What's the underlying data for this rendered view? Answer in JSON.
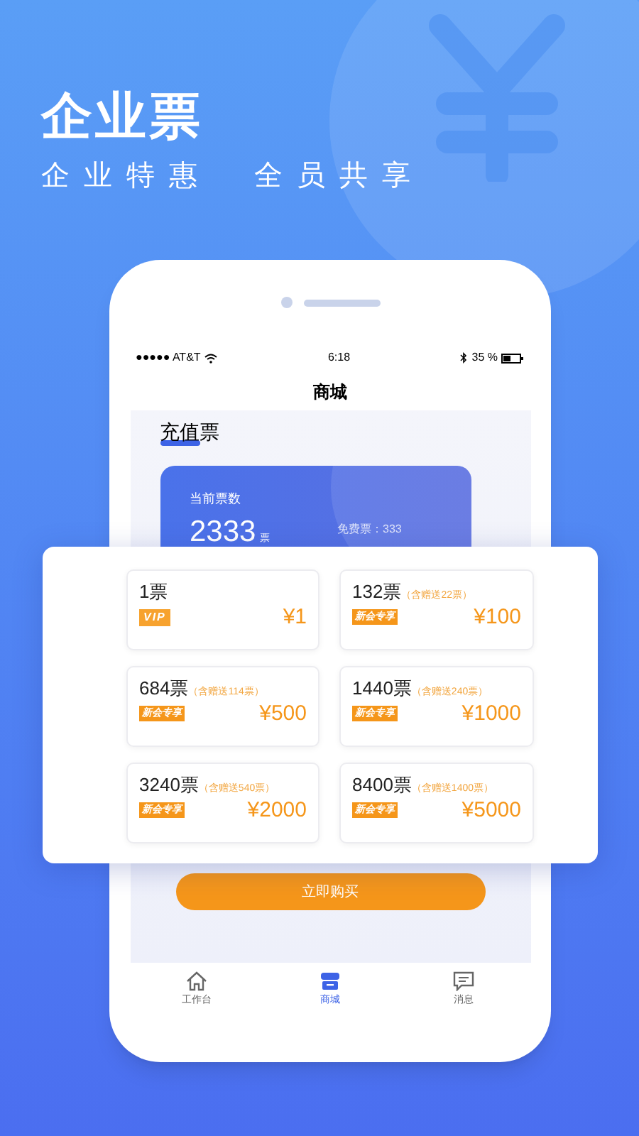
{
  "headline": {
    "title": "企业票",
    "subtitle_left": "企业特惠",
    "subtitle_right": "全员共享"
  },
  "status_bar": {
    "carrier": "●●●●● AT&T",
    "time": "6:18",
    "battery": "35 %"
  },
  "nav_title": "商城",
  "section_title": "充值票",
  "balance_card": {
    "label": "当前票数",
    "count": "2333",
    "unit": "票",
    "free": "免费票：333"
  },
  "packages": [
    {
      "tickets": "1票",
      "kind": "vip",
      "badge": "VIP",
      "price": "¥1"
    },
    {
      "tickets": "132票",
      "bonus": "（含赠送22票）",
      "kind": "new",
      "badge": "新会专享",
      "price": "¥100"
    },
    {
      "tickets": "684票",
      "bonus": "（含赠送114票）",
      "kind": "new",
      "badge": "新会专享",
      "price": "¥500"
    },
    {
      "tickets": "1440票",
      "bonus": "（含赠送240票）",
      "kind": "new",
      "badge": "新会专享",
      "price": "¥1000"
    },
    {
      "tickets": "3240票",
      "bonus": "（含赠送540票）",
      "kind": "new",
      "badge": "新会专享",
      "price": "¥2000"
    },
    {
      "tickets": "8400票",
      "bonus": "（含赠送1400票）",
      "kind": "new",
      "badge": "新会专享",
      "price": "¥5000"
    }
  ],
  "buy_button": "立即购买",
  "tabs": [
    {
      "label": "工作台",
      "kind": "home",
      "selected": false
    },
    {
      "label": "商城",
      "kind": "shop",
      "selected": true
    },
    {
      "label": "消息",
      "kind": "message",
      "selected": false
    }
  ]
}
